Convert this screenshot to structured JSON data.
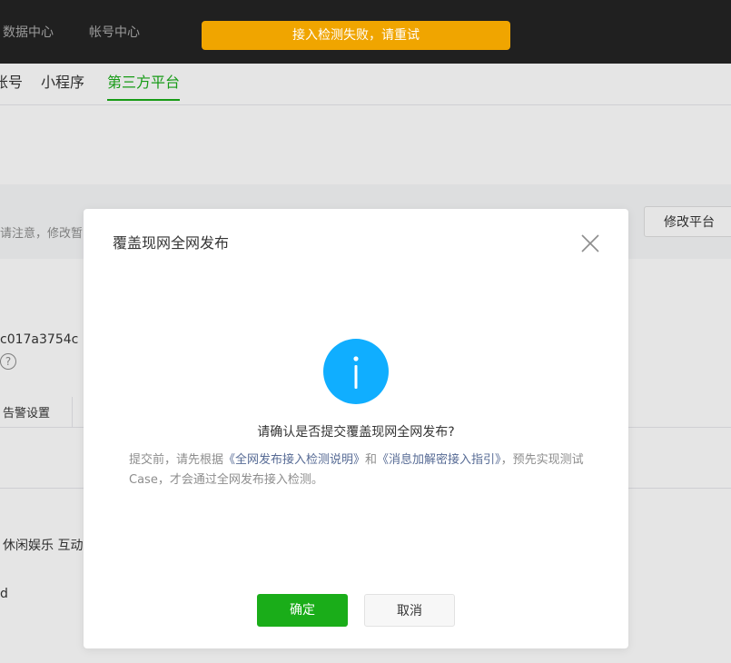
{
  "topbar": {
    "nav": [
      "数据中心",
      "帐号中心"
    ]
  },
  "toast": {
    "message": "接入检测失败，请重试"
  },
  "tabs": [
    "账号",
    "小程序",
    "第三方平台"
  ],
  "background": {
    "notice_text": "请注意，修改暂",
    "modify_platform_label": "修改平台",
    "appid_text": "c017a3754c",
    "help_label": "?",
    "alarm_settings_label": "告警设置",
    "categories_text": "休闲娱乐 互动",
    "partial_text": "d"
  },
  "dialog": {
    "title": "覆盖现网全网发布",
    "question": "请确认是否提交覆盖现网全网发布?",
    "detail_before": "提交前，请先根据",
    "link_1": "《全网发布接入检测说明》",
    "detail_mid": "和",
    "link_2": "《消息加解密接入指引》",
    "detail_after": "，预先实现测试Case，才会通过全网发布接入检测。",
    "confirm_label": "确定",
    "cancel_label": "取消"
  },
  "colors": {
    "accent": "#1aad19",
    "toast": "#f0a500",
    "info": "#10aeff",
    "link": "#576b95",
    "topbar": "#202020"
  },
  "icons": {
    "close": "close-icon",
    "info": "info-icon",
    "help": "help-circle-icon"
  }
}
